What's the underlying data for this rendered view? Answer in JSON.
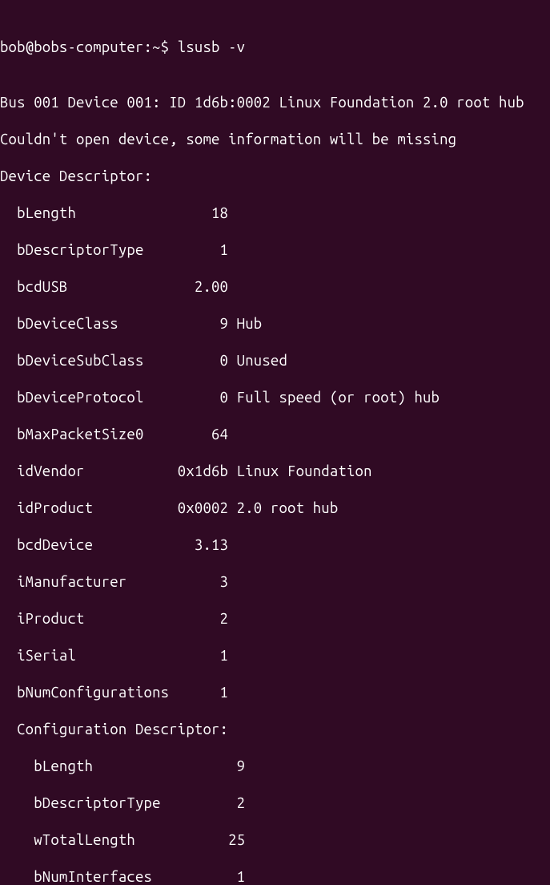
{
  "prompt": "bob@bobs-computer:~$ ",
  "command": "lsusb -v",
  "blank": "",
  "device_header": "Bus 001 Device 001: ID 1d6b:0002 Linux Foundation 2.0 root hub",
  "warning": "Couldn't open device, some information will be missing",
  "descriptor_title": "Device Descriptor:",
  "fields": {
    "bLength": "  bLength                18",
    "bDescriptorType": "  bDescriptorType         1",
    "bcdUSB": "  bcdUSB               2.00",
    "bDeviceClass": "  bDeviceClass            9 Hub",
    "bDeviceSubClass": "  bDeviceSubClass         0 Unused",
    "bDeviceProtocol": "  bDeviceProtocol         0 Full speed (or root) hub",
    "bMaxPacketSize0": "  bMaxPacketSize0        64",
    "idVendor": "  idVendor           0x1d6b Linux Foundation",
    "idProduct": "  idProduct          0x0002 2.0 root hub",
    "bcdDevice": "  bcdDevice            3.13",
    "iManufacturer": "  iManufacturer           3",
    "iProduct": "  iProduct                2",
    "iSerial": "  iSerial                 1",
    "bNumConfigurations": "  bNumConfigurations      1"
  },
  "config_title": "  Configuration Descriptor:",
  "config_fields": {
    "bLength": "    bLength                 9",
    "bDescriptorType": "    bDescriptorType         2",
    "wTotalLength": "    wTotalLength           25",
    "bNumInterfaces": "    bNumInterfaces          1"
  }
}
